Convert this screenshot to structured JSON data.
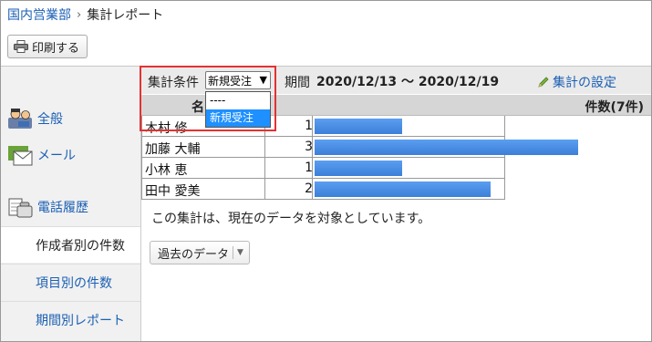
{
  "breadcrumb": {
    "parent": "国内営業部",
    "separator": "›",
    "current": "集計レポート"
  },
  "toolbar": {
    "print_label": "印刷する"
  },
  "sidebar": {
    "items": [
      {
        "label": "全般",
        "icon": "general-people-icon"
      },
      {
        "label": "メール",
        "icon": "mail-icon"
      },
      {
        "label": "電話履歴",
        "icon": "phone-history-icon"
      }
    ],
    "subitems": [
      {
        "label": "作成者別の件数",
        "active": true
      },
      {
        "label": "項目別の件数",
        "active": false
      },
      {
        "label": "期間別レポート",
        "active": false
      }
    ]
  },
  "report": {
    "condition_label": "集計条件",
    "condition_value": "新規受注",
    "condition_options": [
      "----",
      "新規受注"
    ],
    "period_label": "期間",
    "period_value": "2020/12/13 〜 2020/12/19",
    "settings_label": "集計の設定",
    "header_name": "名",
    "header_count": "件数(7件)",
    "rows": [
      {
        "name": "木村 修",
        "count": "1",
        "value": 1
      },
      {
        "name": "加藤 大輔",
        "count": "3",
        "value": 3
      },
      {
        "name": "小林 恵",
        "count": "1",
        "value": 1
      },
      {
        "name": "田中 愛美",
        "count": "2",
        "value": 2
      }
    ],
    "note": "この集計は、現在のデータを対象としています。",
    "past_button": "過去のデータ"
  },
  "colors": {
    "bar": "#4a8fe6",
    "highlight": "#e53131",
    "link": "#1a5fb4"
  }
}
